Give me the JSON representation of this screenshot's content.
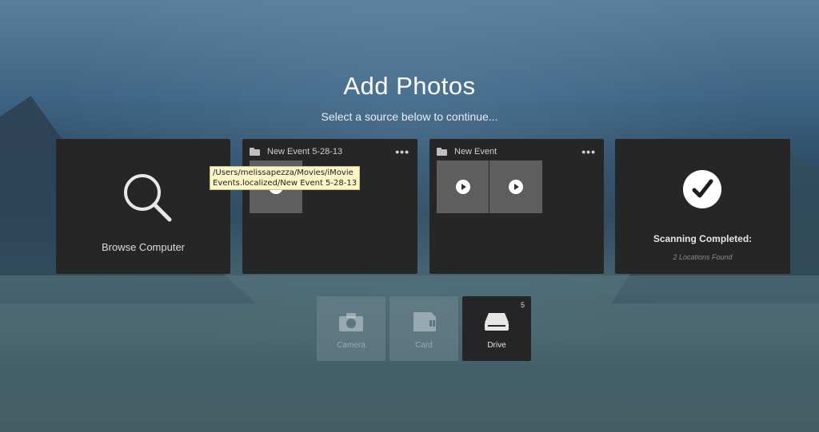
{
  "header": {
    "title": "Add Photos",
    "subtitle": "Select a source below to continue..."
  },
  "sources": {
    "browse": {
      "label": "Browse Computer",
      "icon": "search-icon"
    },
    "event1": {
      "name": "New Event 5-28-13",
      "more": "•••",
      "tooltip_line1": "/Users/melissapezza/Movies/iMovie",
      "tooltip_line2": "Events.localized/New Event 5-28-13"
    },
    "event2": {
      "name": "New Event",
      "more": "•••"
    },
    "scan": {
      "status": "Scanning Completed:",
      "detail": "2 Locations Found",
      "icon": "checkmark-icon"
    }
  },
  "devices": {
    "camera": {
      "label": "Camera",
      "icon": "camera-icon"
    },
    "card": {
      "label": "Card",
      "icon": "memory-card-icon"
    },
    "drive": {
      "label": "Drive",
      "count": "5",
      "icon": "drive-icon"
    }
  }
}
